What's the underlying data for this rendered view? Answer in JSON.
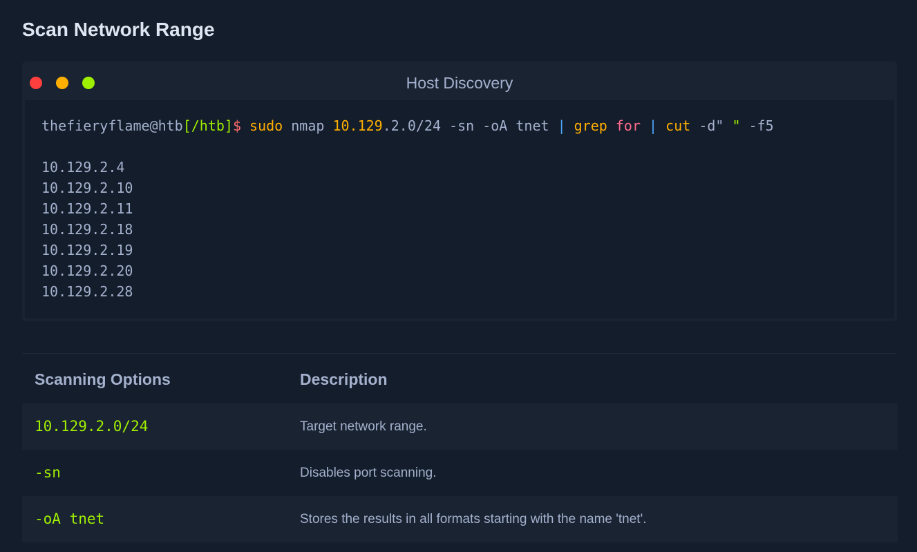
{
  "page": {
    "title": "Scan Network Range"
  },
  "terminal": {
    "title": "Host Discovery",
    "prompt": {
      "user_host": "thefieryflame@htb",
      "path": "[/htb]",
      "symbol": "$"
    },
    "command": {
      "sudo": "sudo",
      "tool": " nmap ",
      "ip_prefix": "10.129",
      "ip_rest": ".2.0/24 -sn -oA tnet ",
      "pipe1": "|",
      "grep": " grep ",
      "grep_term": "for",
      "pipe2": " |",
      "cut": " cut",
      "cut_args": " -d\" ",
      "quote": "\"",
      "cut_field": " -f5"
    },
    "output": [
      "10.129.2.4",
      "10.129.2.10",
      "10.129.2.11",
      "10.129.2.18",
      "10.129.2.19",
      "10.129.2.20",
      "10.129.2.28"
    ]
  },
  "table": {
    "headers": [
      "Scanning Options",
      "Description"
    ],
    "rows": [
      {
        "option": "10.129.2.0/24",
        "description": "Target network range."
      },
      {
        "option": "-sn",
        "description": "Disables port scanning."
      },
      {
        "option": "-oA tnet",
        "description": "Stores the results in all formats starting with the name 'tnet'."
      }
    ]
  },
  "colors": {
    "background": "#141d2b",
    "panel": "#1a2332",
    "accent_green": "#9fef00",
    "accent_red": "#ff3e3e",
    "accent_orange": "#ffaf00"
  }
}
